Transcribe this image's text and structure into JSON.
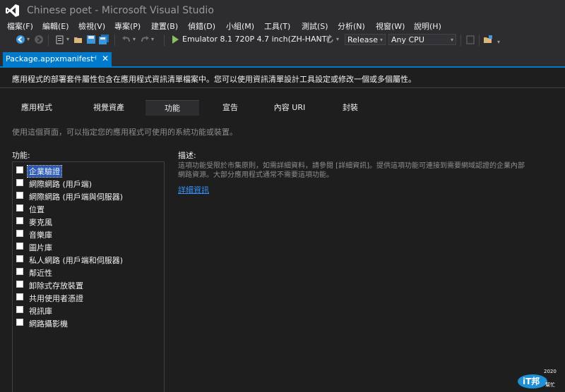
{
  "window": {
    "title": "Chinese poet - Microsoft Visual Studio"
  },
  "menu": [
    {
      "label": "檔案(F)"
    },
    {
      "label": "編輯(E)"
    },
    {
      "label": "檢視(V)"
    },
    {
      "label": "專案(P)"
    },
    {
      "label": "建置(B)"
    },
    {
      "label": "偵錯(D)"
    },
    {
      "label": "小組(M)"
    },
    {
      "label": "工具(T)"
    },
    {
      "label": "測試(S)"
    },
    {
      "label": "分析(N)"
    },
    {
      "label": "視窗(W)"
    },
    {
      "label": "說明(H)"
    }
  ],
  "toolbar": {
    "run_target": "Emulator 8.1 720P 4.7 inch(ZH-HANT)",
    "configuration": "Release",
    "platform": "Any CPU"
  },
  "document_tab": {
    "label": "Package.appxmanifest",
    "pin_glyph": "⊣",
    "close_glyph": "✕"
  },
  "editor": {
    "intro": "應用程式的部署套件屬性包含在應用程式資訊清單檔案中。您可以使用資訊清單設計工具設定或修改一個或多個屬性。",
    "tabs": [
      {
        "label": "應用程式"
      },
      {
        "label": "視覺資產"
      },
      {
        "label": "功能"
      },
      {
        "label": "宣告"
      },
      {
        "label": "內容 URI"
      },
      {
        "label": "封裝"
      }
    ],
    "active_tab": "功能",
    "hint": "使用這個頁面，可以指定您的應用程式可使用的系統功能或裝置。",
    "capabilities_label": "功能:",
    "capabilities": [
      {
        "label": "企業驗證",
        "checked": false,
        "selected": true
      },
      {
        "label": "網際網路 (用戶端)",
        "checked": false
      },
      {
        "label": "網際網路 (用戶端與伺服器)",
        "checked": false
      },
      {
        "label": "位置",
        "checked": false
      },
      {
        "label": "麥克風",
        "checked": false
      },
      {
        "label": "音樂庫",
        "checked": false
      },
      {
        "label": "圖片庫",
        "checked": false
      },
      {
        "label": "私人網路 (用戶端和伺服器)",
        "checked": false
      },
      {
        "label": "鄰近性",
        "checked": false
      },
      {
        "label": "卸除式存放裝置",
        "checked": false
      },
      {
        "label": "共用使用者憑證",
        "checked": false
      },
      {
        "label": "視訊庫",
        "checked": false
      },
      {
        "label": "網路攝影機",
        "checked": false
      }
    ],
    "description_label": "描述:",
    "description": "這項功能受限於市集原則，如需詳細資料，請參閱 [詳細資訊]。提供這項功能可連接到需要網域認證的企業內部網路資源。大部分應用程式通常不需要這項功能。",
    "more_info_link": "詳細資訊"
  },
  "watermark": {
    "brand": "iT邦",
    "brand_sub": "幫忙",
    "badge": "2020"
  },
  "colors": {
    "accent": "#007acc",
    "selection": "#2a59b8",
    "link": "#3794ff",
    "run": "#8ac165"
  }
}
